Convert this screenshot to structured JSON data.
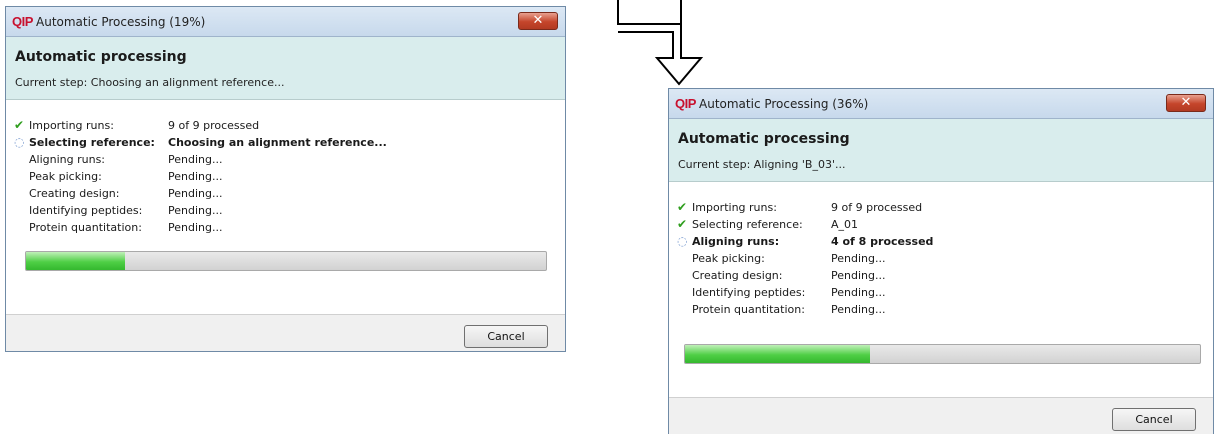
{
  "dialog1": {
    "window_title": "Automatic Processing (19%)",
    "heading": "Automatic processing",
    "current_step": "Current step: Choosing an alignment reference...",
    "progress_percent": 19,
    "cancel_label": "Cancel",
    "close_glyph": "✕",
    "steps": [
      {
        "status": "done",
        "label": "Importing runs:",
        "value": "9 of 9 processed"
      },
      {
        "status": "active",
        "label": "Selecting reference:",
        "value": "Choosing an alignment reference..."
      },
      {
        "status": "pending",
        "label": "Aligning runs:",
        "value": "Pending..."
      },
      {
        "status": "pending",
        "label": "Peak picking:",
        "value": "Pending..."
      },
      {
        "status": "pending",
        "label": "Creating design:",
        "value": "Pending..."
      },
      {
        "status": "pending",
        "label": "Identifying peptides:",
        "value": "Pending..."
      },
      {
        "status": "pending",
        "label": "Protein quantitation:",
        "value": "Pending..."
      }
    ]
  },
  "dialog2": {
    "window_title": "Automatic Processing (36%)",
    "heading": "Automatic processing",
    "current_step": "Current step: Aligning 'B_03'...",
    "progress_percent": 36,
    "cancel_label": "Cancel",
    "close_glyph": "✕",
    "steps": [
      {
        "status": "done",
        "label": "Importing runs:",
        "value": "9 of 9 processed"
      },
      {
        "status": "done",
        "label": "Selecting reference:",
        "value": "A_01"
      },
      {
        "status": "active",
        "label": "Aligning runs:",
        "value": "4 of 8 processed"
      },
      {
        "status": "pending",
        "label": "Peak picking:",
        "value": "Pending..."
      },
      {
        "status": "pending",
        "label": "Creating design:",
        "value": "Pending..."
      },
      {
        "status": "pending",
        "label": "Identifying peptides:",
        "value": "Pending..."
      },
      {
        "status": "pending",
        "label": "Protein quantitation:",
        "value": "Pending..."
      }
    ]
  },
  "app_icon_text": "QIP",
  "colors": {
    "header_bg": "#d9eded",
    "progress_fill": "#4fcf46",
    "check": "#2f9e1e",
    "close_button": "#c5452b",
    "app_icon": "#c8102e"
  },
  "icons": {
    "done": "check-icon",
    "active": "spinner-icon",
    "close": "close-icon"
  }
}
